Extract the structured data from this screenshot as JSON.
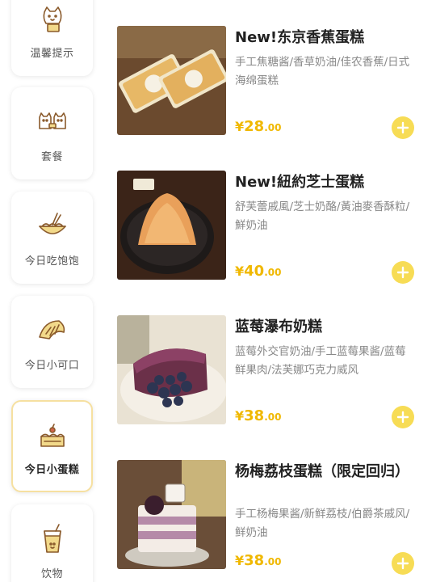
{
  "sidebar": {
    "items": [
      {
        "label": "温馨提示",
        "icon": "cat-note-icon",
        "active": false
      },
      {
        "label": "套餐",
        "icon": "cat-pair-icon",
        "active": false
      },
      {
        "label": "今日吃饱饱",
        "icon": "noodle-bowl-icon",
        "active": false
      },
      {
        "label": "今日小可口",
        "icon": "croissant-icon",
        "active": false
      },
      {
        "label": "今日小蛋糕",
        "icon": "cake-icon",
        "active": true
      },
      {
        "label": "饮物",
        "icon": "drink-cup-icon",
        "active": false
      }
    ]
  },
  "products": [
    {
      "name": "New!东京香蕉蛋糕",
      "desc": "手工焦糖酱/香草奶油/佳农香蕉/日式海绵蛋糕",
      "currency": "¥",
      "price_int": "28",
      "price_dec": ".00"
    },
    {
      "name": "New!紐約芝士蛋糕",
      "desc": "舒芙蕾戚風/芝士奶酪/黃油麥香酥粒/鮮奶油",
      "currency": "¥",
      "price_int": "40",
      "price_dec": ".00"
    },
    {
      "name": "蓝莓瀑布奶糕",
      "desc": "蓝莓外交官奶油/手工蓝莓果酱/蓝莓鲜果肉/法芙娜巧克力威风",
      "currency": "¥",
      "price_int": "38",
      "price_dec": ".00"
    },
    {
      "name": "杨梅荔枝蛋糕（限定回归）",
      "desc": "手工杨梅果酱/新鲜荔枝/伯爵茶戚风/鲜奶油",
      "currency": "¥",
      "price_int": "38",
      "price_dec": ".00"
    }
  ],
  "colors": {
    "accent": "#f0b800",
    "add_button": "#f7dc55",
    "active_border": "#f6e0a0",
    "icon_stroke": "#8a5a2b"
  }
}
